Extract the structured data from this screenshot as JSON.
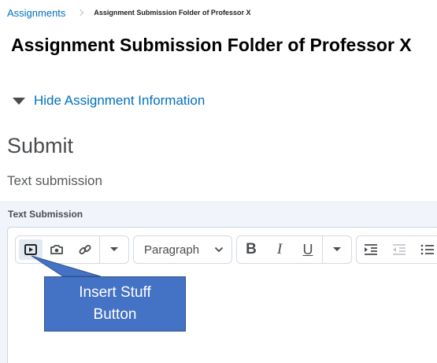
{
  "breadcrumb": {
    "link": "Assignments",
    "current": "Assignment Submission Folder of Professor X"
  },
  "page": {
    "title": "Assignment Submission Folder of Professor X",
    "toggle_label": "Hide Assignment Information",
    "submit_heading": "Submit",
    "text_submission_label": "Text submission"
  },
  "editor": {
    "label": "Text Submission",
    "toolbar": {
      "insert_icon": "play-icon",
      "capture_icon": "camera-icon",
      "link_icon": "link-icon",
      "paragraph_value": "Paragraph",
      "bold": "B",
      "italic": "I",
      "underline": "U"
    }
  },
  "annotation": {
    "line1": "Insert Stuff",
    "line2": "Button"
  },
  "colors": {
    "link": "#006fbf",
    "callout": "#4472c4",
    "panel": "#f1f5fb"
  }
}
